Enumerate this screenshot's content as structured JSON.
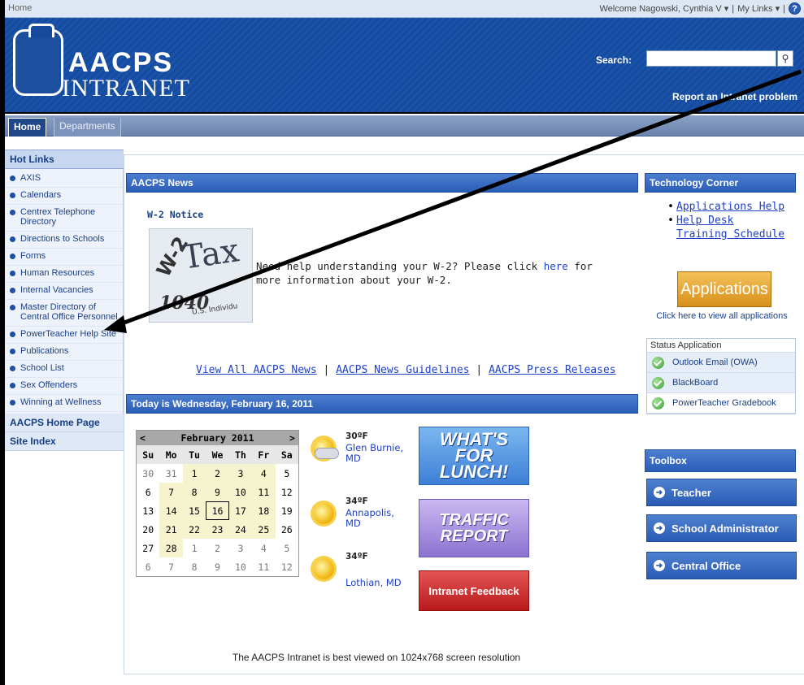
{
  "topbar": {
    "breadcrumb": "Home",
    "welcome": "Welcome Nagowski, Cynthia V",
    "welcome_caret": "▾",
    "separator": "|",
    "my_links": "My Links",
    "my_links_caret": "▾",
    "help_glyph": "?"
  },
  "header": {
    "logo_title": "AACPS",
    "logo_subtitle": "INTRANET",
    "search_label": "Search:",
    "search_value": "",
    "search_button_glyph": "⚲",
    "report_link": "Report an Intranet problem"
  },
  "nav": {
    "tabs": [
      {
        "label": "Home"
      },
      {
        "label": "Departments"
      }
    ]
  },
  "sidebar": {
    "hot_links_title": "Hot Links",
    "items": [
      {
        "label": "AXIS"
      },
      {
        "label": "Calendars"
      },
      {
        "label": "Centrex Telephone Directory"
      },
      {
        "label": "Directions to Schools"
      },
      {
        "label": "Forms"
      },
      {
        "label": "Human Resources"
      },
      {
        "label": "Internal Vacancies"
      },
      {
        "label": "Master Directory of Central Office Personnel"
      },
      {
        "label": "PowerTeacher Help Site"
      },
      {
        "label": "Publications"
      },
      {
        "label": "School List"
      },
      {
        "label": "Sex Offenders"
      },
      {
        "label": "Winning at Wellness"
      }
    ],
    "home_page_link": "AACPS Home Page",
    "site_index_link": "Site Index"
  },
  "news": {
    "section_title": "AACPS News",
    "item_title": "W-2 Notice",
    "image_words": {
      "tax": "Tax",
      "w2": "W-2",
      "form": "1040",
      "us": "U.S. Individu"
    },
    "body_prefix": "Need help understanding your W-2? Please click ",
    "body_link": "here",
    "body_suffix": " for more information about your W-2.",
    "links": [
      {
        "label": "View All AACPS News"
      },
      {
        "label": "AACPS News Guidelines"
      },
      {
        "label": "AACPS Press Releases"
      }
    ],
    "link_separator": "|"
  },
  "today": {
    "title": "Today is Wednesday, February 16, 2011"
  },
  "calendar": {
    "prev": "<",
    "next": ">",
    "month_label": "February 2011",
    "days_of_week": [
      "Su",
      "Mo",
      "Tu",
      "We",
      "Th",
      "Fr",
      "Sa"
    ],
    "weeks": [
      [
        "30",
        "31",
        "1",
        "2",
        "3",
        "4",
        "5"
      ],
      [
        "6",
        "7",
        "8",
        "9",
        "10",
        "11",
        "12"
      ],
      [
        "13",
        "14",
        "15",
        "16",
        "17",
        "18",
        "19"
      ],
      [
        "20",
        "21",
        "22",
        "23",
        "24",
        "25",
        "26"
      ],
      [
        "27",
        "28",
        "1",
        "2",
        "3",
        "4",
        "5"
      ],
      [
        "6",
        "7",
        "8",
        "9",
        "10",
        "11",
        "12"
      ]
    ],
    "today": "16"
  },
  "weather": [
    {
      "temp": "30ºF",
      "city": "Glen Burnie, MD",
      "icon": "partly-cloudy-icon"
    },
    {
      "temp": "34ºF",
      "city": "Annapolis, MD",
      "icon": "sun-icon"
    },
    {
      "temp": "34ºF",
      "city": "Lothian, MD",
      "icon": "sun-icon"
    }
  ],
  "banners": {
    "lunch": "WHAT'S FOR LUNCH!",
    "traffic": "TRAFFIC REPORT",
    "feedback": "Intranet Feedback"
  },
  "resolution_note": "The AACPS Intranet is best viewed on 1024x768 screen resolution",
  "tech_corner": {
    "title": "Technology Corner",
    "links": [
      {
        "label": "Applications Help"
      },
      {
        "label": "Help Desk Training Schedule"
      }
    ],
    "bullet": "•",
    "apps_button": "Applications",
    "apps_caption": "Click here to view all applications",
    "status_header": "Status Application",
    "status_rows": [
      {
        "label": "Outlook Email (OWA)"
      },
      {
        "label": "BlackBoard"
      },
      {
        "label": "PowerTeacher Gradebook"
      }
    ]
  },
  "toolbox": {
    "title": "Toolbox",
    "items": [
      {
        "label": "Teacher"
      },
      {
        "label": "School Administrator"
      },
      {
        "label": "Central Office"
      }
    ],
    "arrow_glyph": "➜"
  }
}
